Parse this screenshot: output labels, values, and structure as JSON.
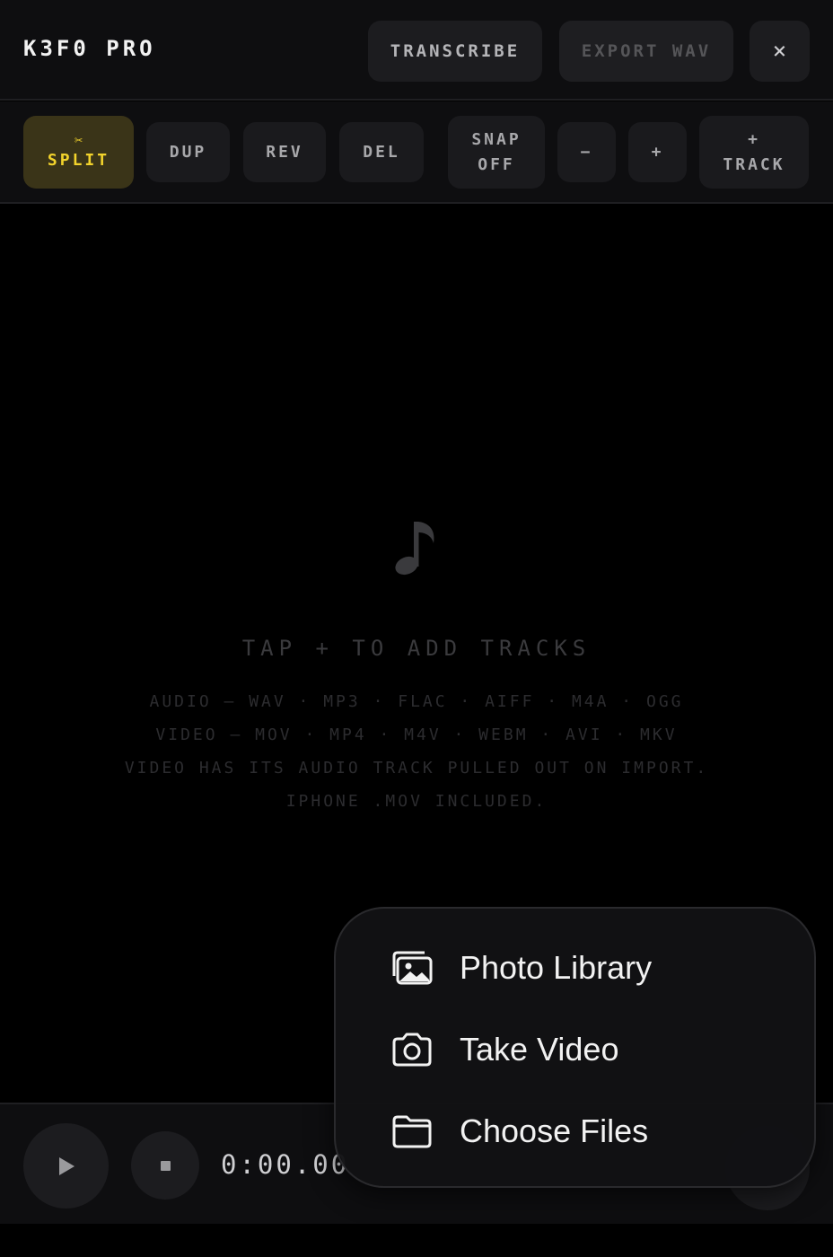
{
  "header": {
    "title": "K3F0 PRO",
    "transcribe_label": "TRANSCRIBE",
    "export_label": "EXPORT WAV",
    "close_label": "×"
  },
  "toolbar": {
    "split_icon": "✂",
    "split_label": "SPLIT",
    "dup_label": "DUP",
    "rev_label": "REV",
    "del_label": "DEL",
    "snap_line1": "SNAP",
    "snap_line2": "OFF",
    "zoom_out_label": "−",
    "zoom_in_label": "+",
    "add_track_line1": "+",
    "add_track_line2": "TRACK"
  },
  "empty_state": {
    "icon": "music-note-icon",
    "title": "TAP + TO ADD TRACKS",
    "line1": "AUDIO — WAV · MP3 · FLAC · AIFF · M4A · OGG",
    "line2": "VIDEO — MOV · MP4 · M4V · WEBM · AVI · MKV",
    "line3": "VIDEO HAS ITS AUDIO TRACK PULLED OUT ON IMPORT.",
    "line4": "IPHONE .MOV INCLUDED."
  },
  "transport": {
    "timecode": "0:00.00"
  },
  "popover": {
    "items": [
      {
        "label": "Photo Library",
        "icon": "photo-library-icon"
      },
      {
        "label": "Take Video",
        "icon": "camera-icon"
      },
      {
        "label": "Choose Files",
        "icon": "folder-icon"
      }
    ]
  },
  "colors": {
    "accent": "#f2d32c",
    "accent_bg": "#3a3418",
    "background": "#000000",
    "panel": "#0e0e10",
    "button": "#1c1c1f"
  }
}
